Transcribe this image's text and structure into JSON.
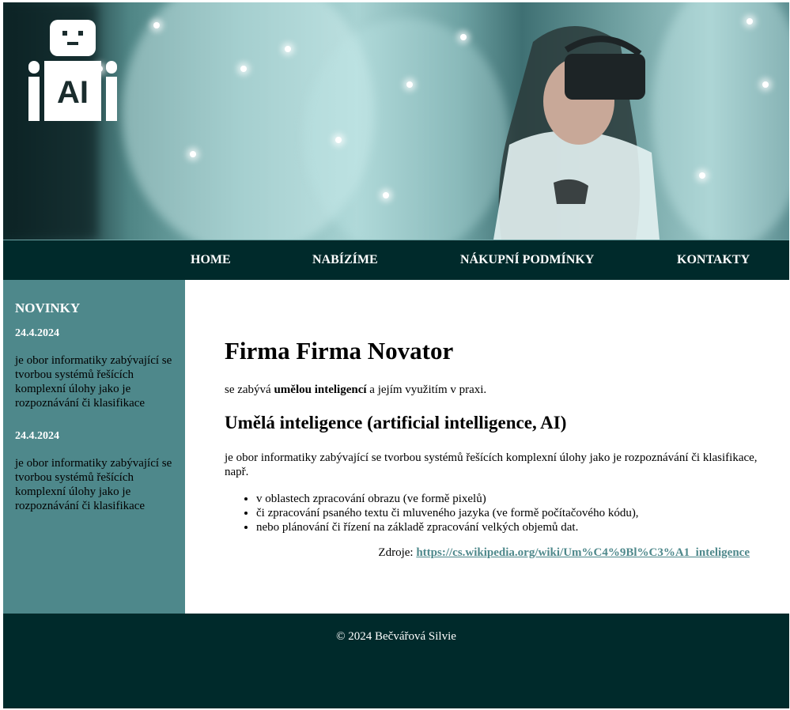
{
  "hero": {
    "logo_text": "AI"
  },
  "nav": {
    "items": [
      {
        "label": "HOME"
      },
      {
        "label": "NABÍZÍME"
      },
      {
        "label": "NÁKUPNÍ PODMÍNKY"
      },
      {
        "label": "KONTAKTY"
      }
    ]
  },
  "sidebar": {
    "title": "NOVINKY",
    "news": [
      {
        "date": "24.4.2024",
        "text": "je obor informatiky zabývající se tvorbou systémů řešících komplexní úlohy jako je rozpoznávání či klasifikace"
      },
      {
        "date": "24.4.2024",
        "text": "je obor informatiky zabývající se tvorbou systémů řešících komplexní úlohy jako je rozpoznávání či klasifikace"
      }
    ]
  },
  "main": {
    "title": "Firma Firma Novator",
    "intro_before": "se zabývá ",
    "intro_bold": "umělou inteligencí",
    "intro_after": " a jejím využitím v praxi.",
    "subtitle": "Umělá inteligence (artificial intelligence, AI)",
    "description": "je obor informatiky zabývající se tvorbou systémů řešících komplexní úlohy jako je rozpoznávání či klasifikace, např.",
    "list": [
      "v oblastech zpracování obrazu (ve formě pixelů)",
      "či zpracování psaného textu či mluveného jazyka (ve formě počítačového kódu),",
      "nebo plánování či řízení na základě zpracování velkých objemů dat."
    ],
    "source_label": "Zdroje: ",
    "source_link": "https://cs.wikipedia.org/wiki/Um%C4%9Bl%C3%A1_inteligence"
  },
  "footer": {
    "text": "© 2024 Bečvářová Silvie"
  },
  "colors": {
    "dark_teal": "#002a2b",
    "sidebar_teal": "#4e888b",
    "link": "#4e888b"
  }
}
